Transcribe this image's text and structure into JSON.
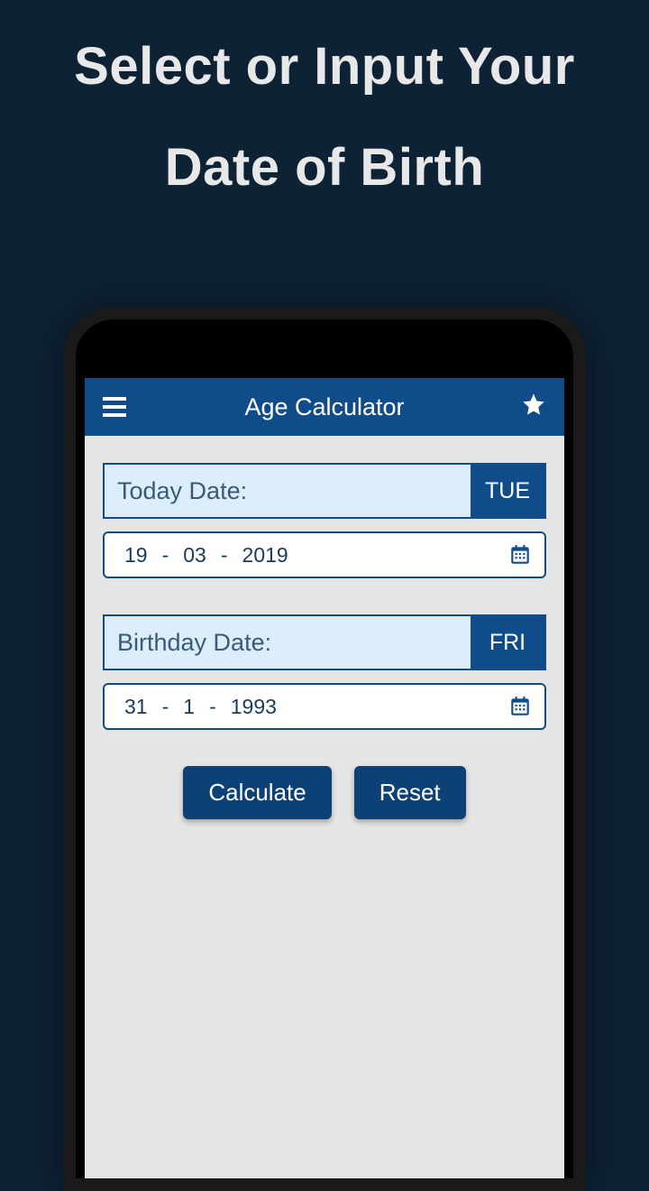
{
  "headline": {
    "line1": "Select or Input Your",
    "line2": "Date of Birth"
  },
  "app": {
    "title": "Age Calculator"
  },
  "today": {
    "label": "Today Date:",
    "dayName": "TUE",
    "day": "19",
    "month": "03",
    "year": "2019"
  },
  "birthday": {
    "label": "Birthday Date:",
    "dayName": "FRI",
    "day": "31",
    "month": "1",
    "year": "1993"
  },
  "buttons": {
    "calculate": "Calculate",
    "reset": "Reset"
  },
  "separator": "-"
}
